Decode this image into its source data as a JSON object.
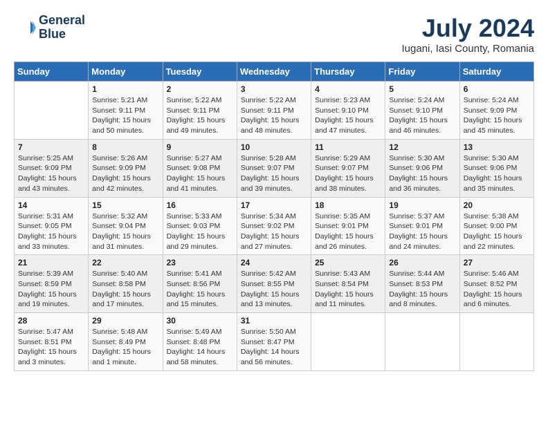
{
  "header": {
    "logo_line1": "General",
    "logo_line2": "Blue",
    "month_year": "July 2024",
    "location": "Iugani, Iasi County, Romania"
  },
  "weekdays": [
    "Sunday",
    "Monday",
    "Tuesday",
    "Wednesday",
    "Thursday",
    "Friday",
    "Saturday"
  ],
  "weeks": [
    [
      {
        "day": "",
        "info": ""
      },
      {
        "day": "1",
        "info": "Sunrise: 5:21 AM\nSunset: 9:11 PM\nDaylight: 15 hours\nand 50 minutes."
      },
      {
        "day": "2",
        "info": "Sunrise: 5:22 AM\nSunset: 9:11 PM\nDaylight: 15 hours\nand 49 minutes."
      },
      {
        "day": "3",
        "info": "Sunrise: 5:22 AM\nSunset: 9:11 PM\nDaylight: 15 hours\nand 48 minutes."
      },
      {
        "day": "4",
        "info": "Sunrise: 5:23 AM\nSunset: 9:10 PM\nDaylight: 15 hours\nand 47 minutes."
      },
      {
        "day": "5",
        "info": "Sunrise: 5:24 AM\nSunset: 9:10 PM\nDaylight: 15 hours\nand 46 minutes."
      },
      {
        "day": "6",
        "info": "Sunrise: 5:24 AM\nSunset: 9:09 PM\nDaylight: 15 hours\nand 45 minutes."
      }
    ],
    [
      {
        "day": "7",
        "info": "Sunrise: 5:25 AM\nSunset: 9:09 PM\nDaylight: 15 hours\nand 43 minutes."
      },
      {
        "day": "8",
        "info": "Sunrise: 5:26 AM\nSunset: 9:09 PM\nDaylight: 15 hours\nand 42 minutes."
      },
      {
        "day": "9",
        "info": "Sunrise: 5:27 AM\nSunset: 9:08 PM\nDaylight: 15 hours\nand 41 minutes."
      },
      {
        "day": "10",
        "info": "Sunrise: 5:28 AM\nSunset: 9:07 PM\nDaylight: 15 hours\nand 39 minutes."
      },
      {
        "day": "11",
        "info": "Sunrise: 5:29 AM\nSunset: 9:07 PM\nDaylight: 15 hours\nand 38 minutes."
      },
      {
        "day": "12",
        "info": "Sunrise: 5:30 AM\nSunset: 9:06 PM\nDaylight: 15 hours\nand 36 minutes."
      },
      {
        "day": "13",
        "info": "Sunrise: 5:30 AM\nSunset: 9:06 PM\nDaylight: 15 hours\nand 35 minutes."
      }
    ],
    [
      {
        "day": "14",
        "info": "Sunrise: 5:31 AM\nSunset: 9:05 PM\nDaylight: 15 hours\nand 33 minutes."
      },
      {
        "day": "15",
        "info": "Sunrise: 5:32 AM\nSunset: 9:04 PM\nDaylight: 15 hours\nand 31 minutes."
      },
      {
        "day": "16",
        "info": "Sunrise: 5:33 AM\nSunset: 9:03 PM\nDaylight: 15 hours\nand 29 minutes."
      },
      {
        "day": "17",
        "info": "Sunrise: 5:34 AM\nSunset: 9:02 PM\nDaylight: 15 hours\nand 27 minutes."
      },
      {
        "day": "18",
        "info": "Sunrise: 5:35 AM\nSunset: 9:01 PM\nDaylight: 15 hours\nand 26 minutes."
      },
      {
        "day": "19",
        "info": "Sunrise: 5:37 AM\nSunset: 9:01 PM\nDaylight: 15 hours\nand 24 minutes."
      },
      {
        "day": "20",
        "info": "Sunrise: 5:38 AM\nSunset: 9:00 PM\nDaylight: 15 hours\nand 22 minutes."
      }
    ],
    [
      {
        "day": "21",
        "info": "Sunrise: 5:39 AM\nSunset: 8:59 PM\nDaylight: 15 hours\nand 19 minutes."
      },
      {
        "day": "22",
        "info": "Sunrise: 5:40 AM\nSunset: 8:58 PM\nDaylight: 15 hours\nand 17 minutes."
      },
      {
        "day": "23",
        "info": "Sunrise: 5:41 AM\nSunset: 8:56 PM\nDaylight: 15 hours\nand 15 minutes."
      },
      {
        "day": "24",
        "info": "Sunrise: 5:42 AM\nSunset: 8:55 PM\nDaylight: 15 hours\nand 13 minutes."
      },
      {
        "day": "25",
        "info": "Sunrise: 5:43 AM\nSunset: 8:54 PM\nDaylight: 15 hours\nand 11 minutes."
      },
      {
        "day": "26",
        "info": "Sunrise: 5:44 AM\nSunset: 8:53 PM\nDaylight: 15 hours\nand 8 minutes."
      },
      {
        "day": "27",
        "info": "Sunrise: 5:46 AM\nSunset: 8:52 PM\nDaylight: 15 hours\nand 6 minutes."
      }
    ],
    [
      {
        "day": "28",
        "info": "Sunrise: 5:47 AM\nSunset: 8:51 PM\nDaylight: 15 hours\nand 3 minutes."
      },
      {
        "day": "29",
        "info": "Sunrise: 5:48 AM\nSunset: 8:49 PM\nDaylight: 15 hours\nand 1 minute."
      },
      {
        "day": "30",
        "info": "Sunrise: 5:49 AM\nSunset: 8:48 PM\nDaylight: 14 hours\nand 58 minutes."
      },
      {
        "day": "31",
        "info": "Sunrise: 5:50 AM\nSunset: 8:47 PM\nDaylight: 14 hours\nand 56 minutes."
      },
      {
        "day": "",
        "info": ""
      },
      {
        "day": "",
        "info": ""
      },
      {
        "day": "",
        "info": ""
      }
    ]
  ]
}
